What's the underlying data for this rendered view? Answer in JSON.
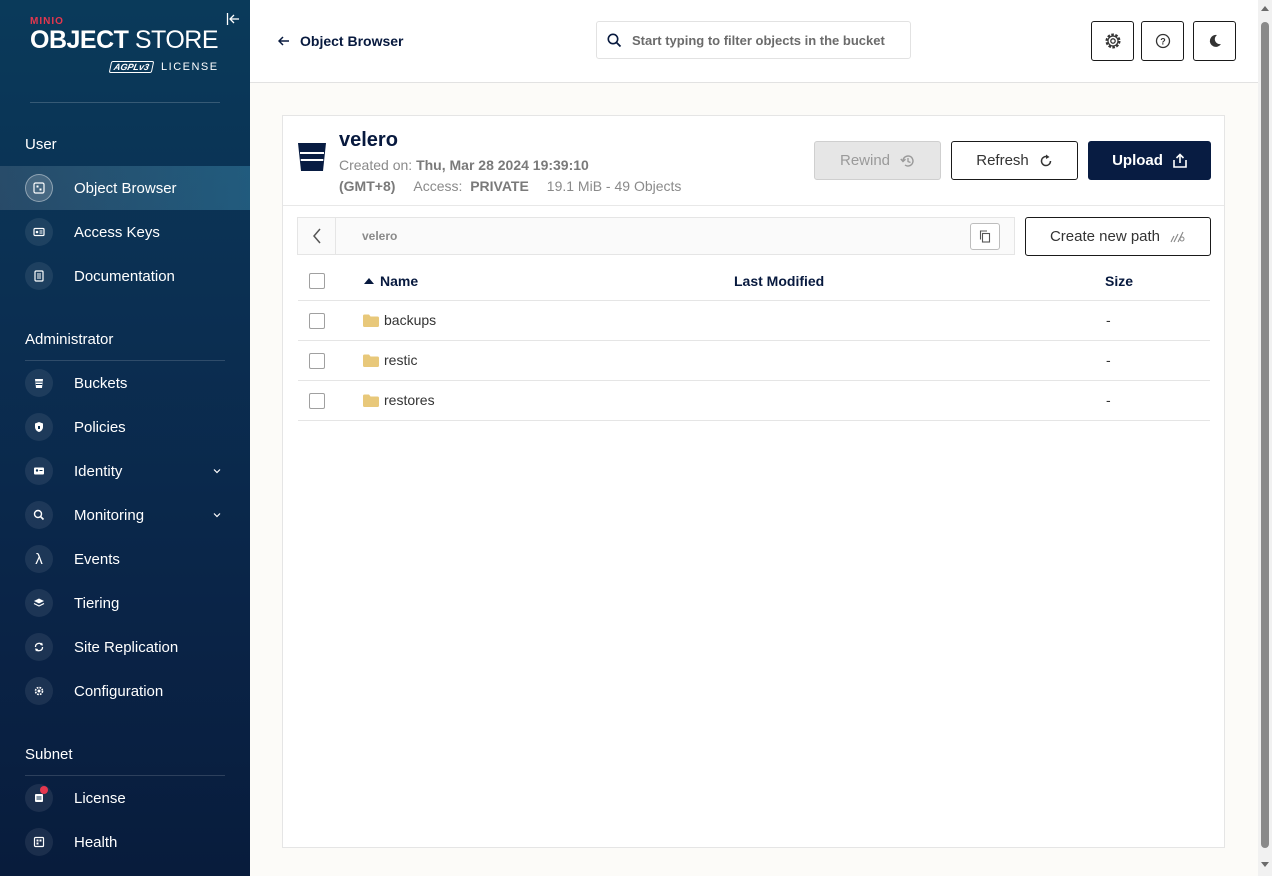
{
  "sidebar": {
    "logo": {
      "brand": "MINIO",
      "product_bold": "OBJECT",
      "product_light": " STORE",
      "badge": "AGPLv3",
      "license_word": "LICENSE"
    },
    "sections": {
      "user": "User",
      "administrator": "Administrator",
      "subnet": "Subnet"
    },
    "user_items": [
      {
        "label": "Object Browser",
        "icon": "object-browser-icon"
      },
      {
        "label": "Access Keys",
        "icon": "access-keys-icon"
      },
      {
        "label": "Documentation",
        "icon": "documentation-icon"
      }
    ],
    "admin_items": [
      {
        "label": "Buckets",
        "icon": "bucket-icon"
      },
      {
        "label": "Policies",
        "icon": "policies-icon"
      },
      {
        "label": "Identity",
        "icon": "identity-icon"
      },
      {
        "label": "Monitoring",
        "icon": "monitoring-icon"
      },
      {
        "label": "Events",
        "icon": "lambda-icon"
      },
      {
        "label": "Tiering",
        "icon": "tiering-icon"
      },
      {
        "label": "Site Replication",
        "icon": "replication-icon"
      },
      {
        "label": "Configuration",
        "icon": "gear-icon"
      }
    ],
    "subnet_items": [
      {
        "label": "License",
        "icon": "license-icon"
      },
      {
        "label": "Health",
        "icon": "health-icon"
      }
    ]
  },
  "header": {
    "back_label": "Object Browser",
    "search_placeholder": "Start typing to filter objects in the bucket"
  },
  "bucket": {
    "name": "velero",
    "created_label": "Created on:",
    "created_value": "Thu, Mar 28 2024 19:39:10",
    "timezone": "(GMT+8)",
    "access_label": "Access:",
    "access_value": "PRIVATE",
    "usage": "19.1 MiB - 49 Objects"
  },
  "actions": {
    "rewind": "Rewind",
    "refresh": "Refresh",
    "upload": "Upload",
    "create_path": "Create new path"
  },
  "breadcrumb": {
    "path": "velero"
  },
  "table": {
    "headers": {
      "name": "Name",
      "modified": "Last Modified",
      "size": "Size"
    },
    "rows": [
      {
        "name": "backups",
        "modified": "",
        "size": "-"
      },
      {
        "name": "restic",
        "modified": "",
        "size": "-"
      },
      {
        "name": "restores",
        "modified": "",
        "size": "-"
      }
    ]
  },
  "colors": {
    "sidebar_dark": "#081c3c",
    "primary": "#081c42",
    "accent_red": "#e5374e",
    "folder": "#e8c87a"
  }
}
